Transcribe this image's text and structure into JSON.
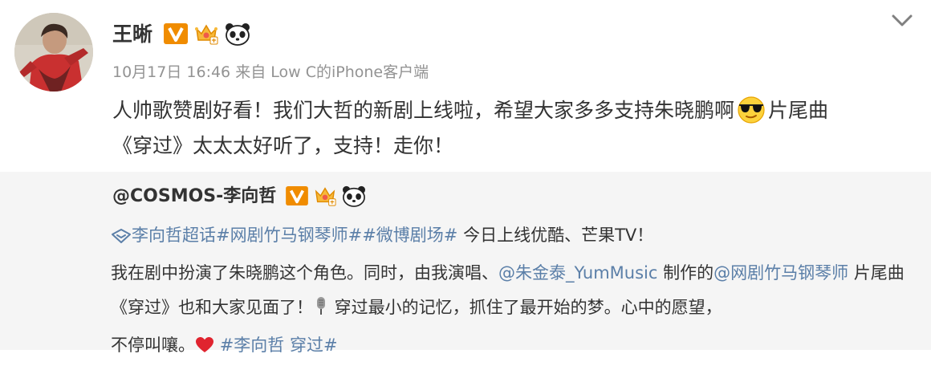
{
  "post": {
    "username": "王晰",
    "timestamp": "10月17日 16:46",
    "source_prefix": "来自",
    "source": "Low C的iPhone客户端",
    "content_line1_a": "人帅歌赞剧好看！我们大哲的新剧上线啦，希望大家多多支持朱晓鹏啊",
    "content_line1_b": "片尾曲",
    "content_line2": "《穿过》太太太好听了，支持！走你！"
  },
  "retweet": {
    "username": "@COSMOS-李向哲",
    "supertopic": "李向哲超话",
    "topic1": "#网剧竹马钢琴师#",
    "topic2": "#微博剧场#",
    "line1_rest": " 今日上线优酷、芒果TV！",
    "line2_a": "我在剧中扮演了朱晓鹏这个角色。同时，由我演唱、",
    "mention1": "@朱金泰_YumMusic",
    "line2_b": " 制作的",
    "mention2": "@网剧竹马钢琴师",
    "line3_a": " 片尾曲《穿过》也和大家见面了！",
    "line3_b": " 穿过最小的记忆，抓住了最开始的梦。心中的愿望，",
    "line4_a": "不停叫嚷。",
    "topic3": "#李向哲 穿过#"
  },
  "icons": {
    "verified": "verified-v-badge",
    "member": "crown-member-badge",
    "panda": "panda-badge",
    "menu": "chevron-down-icon",
    "sunglasses": "sunglasses-emoji",
    "supertopic": "supertopic-icon",
    "microphone": "microphone-icon",
    "heart": "heart-emoji"
  },
  "colors": {
    "link": "#5b7fa8",
    "meta": "#939393",
    "badge_orange": "#f08c00",
    "retweet_bg": "#f5f5f5"
  }
}
